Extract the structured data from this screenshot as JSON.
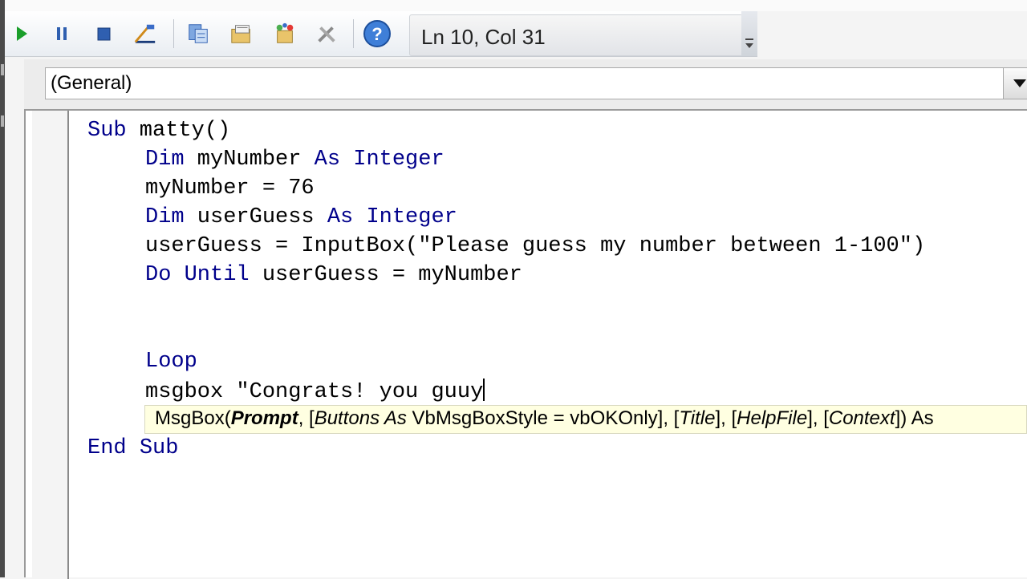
{
  "toolbar": {
    "status": "Ln 10, Col 31",
    "buttons": [
      {
        "name": "run-button",
        "icon": "play-icon"
      },
      {
        "name": "pause-button",
        "icon": "pause-icon"
      },
      {
        "name": "stop-button",
        "icon": "stop-icon"
      },
      {
        "name": "design-mode-button",
        "icon": "design-mode-icon"
      },
      {
        "name": "project-explorer-button",
        "icon": "project-explorer-icon"
      },
      {
        "name": "properties-button",
        "icon": "properties-icon"
      },
      {
        "name": "object-browser-button",
        "icon": "object-browser-icon"
      },
      {
        "name": "toolbox-button",
        "icon": "toolbox-icon"
      },
      {
        "name": "help-button",
        "icon": "help-icon"
      }
    ]
  },
  "combo": {
    "value": "(General)"
  },
  "code": {
    "l1_kw": "Sub",
    "l1_rest": " matty()",
    "l2_kw1": "Dim",
    "l2_mid": " myNumber ",
    "l2_kw2": "As",
    "l2_sp": " ",
    "l2_kw3": "Integer",
    "l3": "myNumber = 76",
    "l4_kw1": "Dim",
    "l4_mid": " userGuess ",
    "l4_kw2": "As",
    "l4_sp": " ",
    "l4_kw3": "Integer",
    "l5": "userGuess = InputBox(\"Please guess my number between 1-100\")",
    "l6_kw1": "Do",
    "l6_sp": " ",
    "l6_kw2": "Until",
    "l6_rest": " userGuess = myNumber",
    "l9_kw": "Loop",
    "l10": "msgbox \"Congrats! you guuy",
    "l12_kw1": "End",
    "l12_sp": " ",
    "l12_kw2": "Sub"
  },
  "tooltip": {
    "t1": "MsgBox(",
    "prompt": "Prompt",
    "t2": ", [",
    "buttons": "Buttons As",
    "t3": " VbMsgBoxStyle = vbOKOnly], [",
    "title": "Title",
    "t4": "], [",
    "helpfile": "HelpFile",
    "t5": "], [",
    "context": "Context",
    "t6": "]) As"
  },
  "colors": {
    "keyword": "#00008b",
    "tooltip_bg": "#ffffe1",
    "run_green": "#1a9e2a"
  }
}
